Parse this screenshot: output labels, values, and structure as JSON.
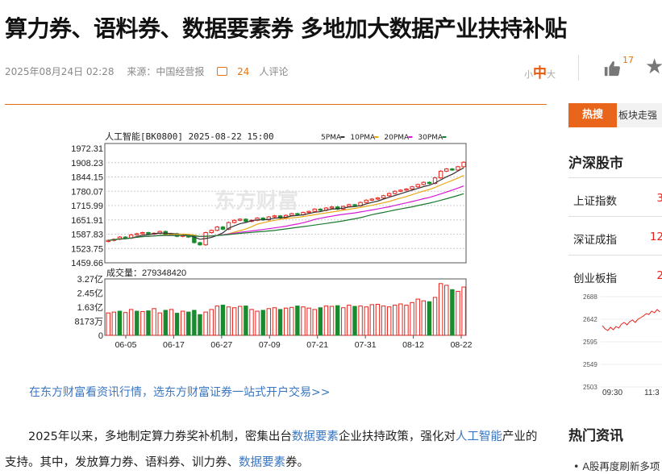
{
  "article": {
    "title": "算力券、语料券、数据要素券 多地加大数据产业扶持补贴",
    "datetime": "2025年08月24日 02:28",
    "source": "来源：中国经营报",
    "comment_count": "24",
    "comment_suffix": "人评论",
    "font_small": "小",
    "font_mid": "中",
    "font_large": "大",
    "like_count": "17",
    "promo_link": "在东方财富看资讯行情，选东方财富证券一站式开户交易>>",
    "para_1": "2025年以来，多地制定算力券奖补机制，密集出台",
    "para_link1": "数据要素",
    "para_2": "企业扶持政策，强化对",
    "para_link2": "人工智能",
    "para_3": "产业的支持。其中，发放算力券、语料券、训力券、",
    "para_link3": "数据要素",
    "para_4": "券。"
  },
  "chart_data": {
    "type": "candlestick",
    "title": "人工智能[BK0800] 2025-08-22 15:00",
    "legend": [
      {
        "name": "5PMA",
        "color": "#333333"
      },
      {
        "name": "10PMA",
        "color": "#e6a817"
      },
      {
        "name": "20PMA",
        "color": "#d51ad5"
      },
      {
        "name": "30PMA",
        "color": "#1a7a2e"
      }
    ],
    "price_ticks": [
      "1972.31",
      "1908.23",
      "1844.15",
      "1780.07",
      "1715.99",
      "1651.91",
      "1587.83",
      "1523.75",
      "1459.66"
    ],
    "ylim": [
      1459.66,
      1972.31
    ],
    "volume_label": "成交量：279348420",
    "volume_ticks": [
      "3.27亿",
      "2.45亿",
      "1.63亿",
      "8173万",
      "0"
    ],
    "volume_max": 327,
    "x_ticks": [
      "06-05",
      "06-17",
      "06-27",
      "07-09",
      "07-21",
      "07-31",
      "08-12",
      "08-22"
    ],
    "watermark": "东方财富",
    "close": [
      1560,
      1565,
      1575,
      1570,
      1585,
      1590,
      1595,
      1588,
      1592,
      1600,
      1585,
      1590,
      1578,
      1582,
      1575,
      1550,
      1540,
      1595,
      1605,
      1620,
      1610,
      1640,
      1650,
      1655,
      1645,
      1650,
      1660,
      1652,
      1665,
      1670,
      1660,
      1672,
      1680,
      1675,
      1685,
      1690,
      1700,
      1695,
      1705,
      1710,
      1700,
      1712,
      1720,
      1715,
      1730,
      1740,
      1745,
      1750,
      1760,
      1770,
      1780,
      1785,
      1790,
      1800,
      1810,
      1820,
      1815,
      1840,
      1870,
      1880,
      1875,
      1890,
      1910
    ],
    "volume": [
      130,
      135,
      140,
      132,
      150,
      140,
      138,
      142,
      155,
      130,
      145,
      150,
      128,
      140,
      135,
      145,
      120,
      135,
      150,
      170,
      175,
      165,
      160,
      168,
      170,
      150,
      140,
      145,
      155,
      160,
      150,
      158,
      162,
      170,
      165,
      158,
      150,
      160,
      170,
      168,
      172,
      160,
      175,
      168,
      170,
      165,
      178,
      180,
      170,
      165,
      175,
      182,
      175,
      190,
      210,
      200,
      195,
      220,
      300,
      290,
      265,
      255,
      280
    ],
    "volume_up": [
      true,
      true,
      false,
      true,
      true,
      false,
      true,
      false,
      true,
      true,
      false,
      true,
      false,
      true,
      false,
      false,
      false,
      true,
      true,
      true,
      false,
      true,
      true,
      true,
      false,
      true,
      true,
      false,
      true,
      true,
      false,
      true,
      true,
      false,
      true,
      true,
      true,
      false,
      true,
      true,
      false,
      true,
      true,
      false,
      true,
      true,
      true,
      true,
      true,
      true,
      true,
      true,
      true,
      true,
      true,
      true,
      false,
      true,
      true,
      true,
      false,
      true,
      true
    ]
  },
  "sidebar": {
    "hot_tag": "热搜",
    "hot_text": "板块走强",
    "market_title": "沪深股市",
    "indices": [
      {
        "name": "上证指数",
        "value": "3"
      },
      {
        "name": "深证成指",
        "value": "12"
      },
      {
        "name": "创业板指",
        "value": "2"
      }
    ],
    "mini_ticks": [
      "2688",
      "2642",
      "2595",
      "2549",
      "2503"
    ],
    "mini_x": [
      "09:30",
      "11:3"
    ],
    "hot_news_title": "热门资讯",
    "news": [
      "A股再度刷新多项"
    ]
  },
  "colors": {
    "up": "#e8221b",
    "down": "#1a8a2e",
    "accent": "#e8651b",
    "link": "#3a77c2"
  }
}
